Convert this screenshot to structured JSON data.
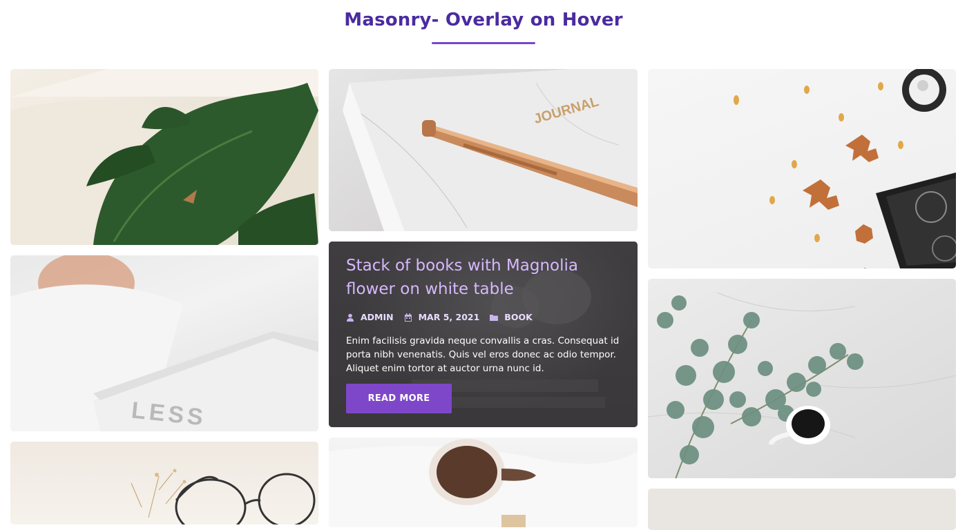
{
  "section": {
    "title": "Masonry- Overlay on Hover",
    "accent_color": "#4a2ba0",
    "underline_color": "#7b45c9"
  },
  "cards": {
    "plant": {
      "image": "monstera-leaf-on-book"
    },
    "less": {
      "image": "white-book-less"
    },
    "glasses": {
      "image": "glasses-dried-flowers"
    },
    "journal": {
      "image": "journal-rose-gold-pen",
      "embossed_text": "JOURNAL"
    },
    "coffee": {
      "image": "coffee-cup-on-sheets"
    },
    "leaves": {
      "image": "autumn-leaves-and-book"
    },
    "eucalyptus": {
      "image": "eucalyptus-and-coffee"
    },
    "beige": {
      "image": "beige-background"
    }
  },
  "featured_post": {
    "title": "Stack of books with Magnolia flower on white table",
    "author": "ADMIN",
    "date": "MAR 5, 2021",
    "category": "BOOK",
    "excerpt": "Enim facilisis gravida neque convallis a cras. Consequat id porta nibh venenatis. Quis vel eros donec ac odio tempor. Aliquet enim tortor at auctor urna nunc id.",
    "read_more_label": "READ MORE",
    "title_color": "#d6b8ff",
    "button_color": "#7e47c9",
    "icons": {
      "author": "user-icon",
      "date": "calendar-icon",
      "category": "folder-icon"
    }
  }
}
